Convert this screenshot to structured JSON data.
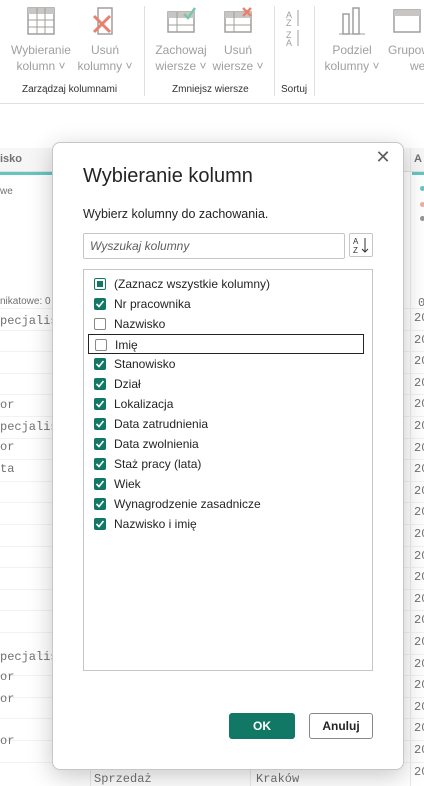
{
  "ribbon": {
    "groups": [
      {
        "label": "Zarządzaj kolumnami"
      },
      {
        "label": "Zmniejsz wiersze"
      },
      {
        "label": "Sortuj"
      }
    ],
    "buttons": {
      "choose_columns": {
        "line1": "Wybieranie",
        "line2": "kolumn ˅",
        "icon": "choose-columns-icon"
      },
      "remove_columns": {
        "line1": "Usuń",
        "line2": "kolumny ˅",
        "icon": "remove-columns-icon"
      },
      "keep_rows": {
        "line1": "Zachowaj",
        "line2": "wiersze ˅",
        "icon": "keep-rows-icon"
      },
      "remove_rows": {
        "line1": "Usuń",
        "line2": "wiersze ˅",
        "icon": "remove-rows-icon"
      },
      "split_column": {
        "line1": "Podziel",
        "line2": "kolumny ˅",
        "icon": "split-column-icon"
      },
      "group_by": {
        "line1": "Grupow",
        "line2": "wed",
        "icon": "group-by-icon"
      }
    }
  },
  "background": {
    "header_left": "isko",
    "header_right": "A",
    "left_cells": [
      "we",
      "nikatowe: 0",
      "pecjalis",
      "or",
      "pecjalis",
      "or",
      "ta",
      "pecjalis",
      "or",
      "or",
      "or"
    ],
    "right_cells": [
      "0",
      "20",
      "20",
      "20",
      "20",
      "20",
      "20",
      "20",
      "20",
      "20",
      "20",
      "20",
      "20",
      "20",
      "20",
      "20",
      "20",
      "20",
      "20",
      "20",
      "20",
      "20",
      "20"
    ],
    "bottom_row": {
      "col1": "Sprzedaż",
      "col2": "Kraków"
    }
  },
  "dialog": {
    "title": "Wybieranie kolumn",
    "subtitle": "Wybierz kolumny do zachowania.",
    "search_placeholder": "Wyszukaj kolumny",
    "sort_icon": "sort-az-icon",
    "close_icon": "close-icon",
    "columns": [
      {
        "label": "(Zaznacz wszystkie kolumny)",
        "state": "partial"
      },
      {
        "label": "Nr pracownika",
        "state": "on"
      },
      {
        "label": "Nazwisko",
        "state": "off"
      },
      {
        "label": "Imię",
        "state": "off"
      },
      {
        "label": "Stanowisko",
        "state": "on"
      },
      {
        "label": "Dział",
        "state": "on"
      },
      {
        "label": "Lokalizacja",
        "state": "on"
      },
      {
        "label": "Data zatrudnienia",
        "state": "on"
      },
      {
        "label": "Data zwolnienia",
        "state": "on"
      },
      {
        "label": "Staż pracy (lata)",
        "state": "on"
      },
      {
        "label": "Wiek",
        "state": "on"
      },
      {
        "label": "Wynagrodzenie zasadnicze",
        "state": "on"
      },
      {
        "label": "Nazwisko i imię",
        "state": "on"
      }
    ],
    "ok_label": "OK",
    "cancel_label": "Anuluj"
  },
  "colors": {
    "accent": "#117865",
    "teal": "#13a89e"
  }
}
